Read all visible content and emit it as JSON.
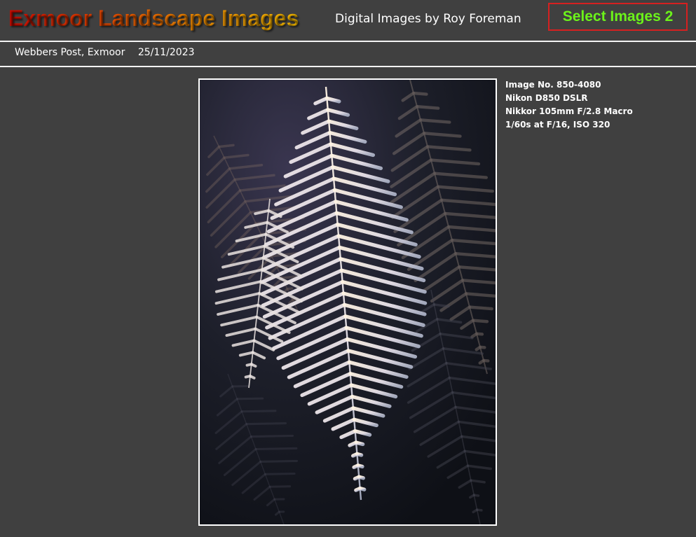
{
  "header": {
    "title": "Exmoor Landscape Images",
    "subtitle": "Digital Images by Roy Foreman",
    "select_button": "Select Images 2"
  },
  "location_bar": {
    "place": "Webbers Post, Exmoor",
    "date": "25/11/2023"
  },
  "photo": {
    "subject_icon": "frosted-fern-photo"
  },
  "exif": {
    "image_no": "Image No. 850-4080",
    "camera": "Nikon D850 DSLR",
    "lens": "Nikkor 105mm F/2.8 Macro",
    "exposure": "1/60s at F/16,  ISO 320"
  },
  "colors": {
    "background": "#404040",
    "select_text": "#6cf21a",
    "select_border": "#d62020"
  }
}
